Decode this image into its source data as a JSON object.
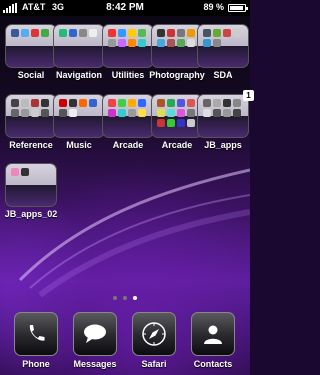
{
  "status_bar": {
    "carrier": "AT&T",
    "network": "3G",
    "time": "8:42 PM",
    "battery": "89 %",
    "battery_level": 0.89
  },
  "home_rows": [
    {
      "label": "Social",
      "icon": "folder-icon"
    },
    {
      "label": "Navigation",
      "icon": "folder-icon"
    },
    {
      "label": "Utilities",
      "icon": "folder-icon"
    },
    {
      "label": "Photography",
      "icon": "folder-icon"
    },
    {
      "label": "SDA",
      "icon": "folder-icon"
    },
    {
      "label": "Reference",
      "icon": "folder-icon"
    },
    {
      "label": "Music",
      "icon": "folder-icon"
    },
    {
      "label": "Arcade",
      "icon": "folder-icon"
    },
    {
      "label": "Arcade",
      "icon": "folder-icon"
    },
    {
      "label": "JB_apps",
      "icon": "folder-icon",
      "badge": "1"
    },
    {
      "label": "JB_apps_02",
      "icon": "folder-icon"
    }
  ],
  "page_indicator": {
    "pages": 3,
    "current": 3
  },
  "dock": [
    {
      "label": "Phone",
      "icon": "phone-icon"
    },
    {
      "label": "Messages",
      "icon": "messages-icon"
    },
    {
      "label": "Safari",
      "icon": "compass-icon"
    },
    {
      "label": "Contacts",
      "icon": "contacts-icon"
    }
  ],
  "colors": {
    "accent": "#6a22b0",
    "status_bar_bg": "#000000"
  }
}
